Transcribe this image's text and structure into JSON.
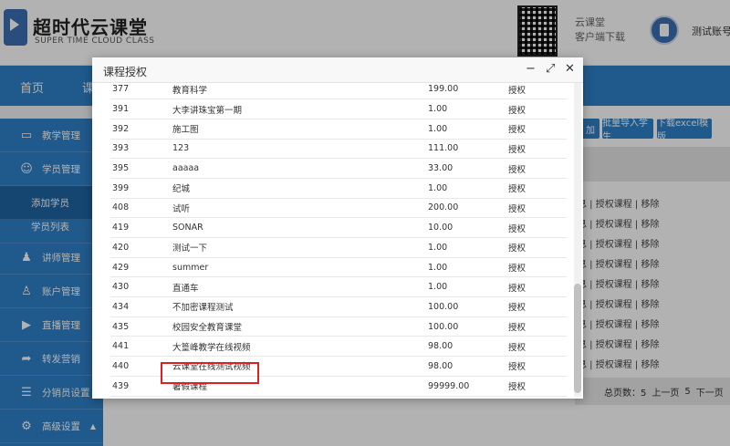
{
  "header": {
    "brand_title": "超时代云课堂",
    "brand_subtitle": "SUPER TIME CLOUD CLASS",
    "qr_caption_1": "云课堂",
    "qr_caption_2": "客户端下载",
    "account": "测试账号"
  },
  "nav": {
    "home": "首页",
    "second": "课"
  },
  "sidebar": {
    "items": [
      {
        "label": "教学管理",
        "icon": "monitor-icon"
      },
      {
        "label": "学员管理",
        "icon": "user-icon"
      },
      {
        "label": "添加学员",
        "sub": true,
        "active": true
      },
      {
        "label": "学员列表",
        "sub": true
      },
      {
        "label": "讲师管理",
        "icon": "teacher-icon"
      },
      {
        "label": "账户管理",
        "icon": "account-icon"
      },
      {
        "label": "直播管理",
        "icon": "live-icon"
      },
      {
        "label": "转发营销",
        "icon": "share-icon"
      },
      {
        "label": "分销员设置",
        "icon": "distributor-icon"
      },
      {
        "label": "高级设置",
        "icon": "gear-icon"
      }
    ]
  },
  "main": {
    "btn_partial": "加",
    "btn_bulk_import": "批量导入学生",
    "btn_download_excel": "下载excel模版",
    "row_ops": "息 | 授权课程 | 移除",
    "footer": {
      "total": "总页数：5",
      "prev": "上一页",
      "page": "5",
      "next": "下一页"
    }
  },
  "dialog": {
    "title": "课程授权",
    "action_label": "授权",
    "rows": [
      {
        "id": "377",
        "name": "教育科学",
        "price": "199.00"
      },
      {
        "id": "391",
        "name": "大李讲珠宝第一期",
        "price": "1.00"
      },
      {
        "id": "392",
        "name": "施工图",
        "price": "1.00"
      },
      {
        "id": "393",
        "name": "123",
        "price": "111.00"
      },
      {
        "id": "395",
        "name": "aaaaa",
        "price": "33.00"
      },
      {
        "id": "399",
        "name": "纪城",
        "price": "1.00"
      },
      {
        "id": "408",
        "name": "试听",
        "price": "200.00"
      },
      {
        "id": "419",
        "name": "SONAR",
        "price": "10.00"
      },
      {
        "id": "420",
        "name": "测试一下",
        "price": "1.00"
      },
      {
        "id": "429",
        "name": "summer",
        "price": "1.00"
      },
      {
        "id": "430",
        "name": "直通车",
        "price": "1.00"
      },
      {
        "id": "434",
        "name": "不加密课程测试",
        "price": "100.00"
      },
      {
        "id": "435",
        "name": "校园安全教育课堂",
        "price": "100.00"
      },
      {
        "id": "441",
        "name": "大篁峰教学在线视频",
        "price": "98.00"
      },
      {
        "id": "440",
        "name": "云课堂在线测试视频",
        "price": "98.00"
      },
      {
        "id": "439",
        "name": "暑假课程",
        "price": "99999.00"
      }
    ]
  },
  "colors": {
    "primary": "#2f80c8",
    "link": "#2f73c0",
    "highlight": "#e02020"
  }
}
